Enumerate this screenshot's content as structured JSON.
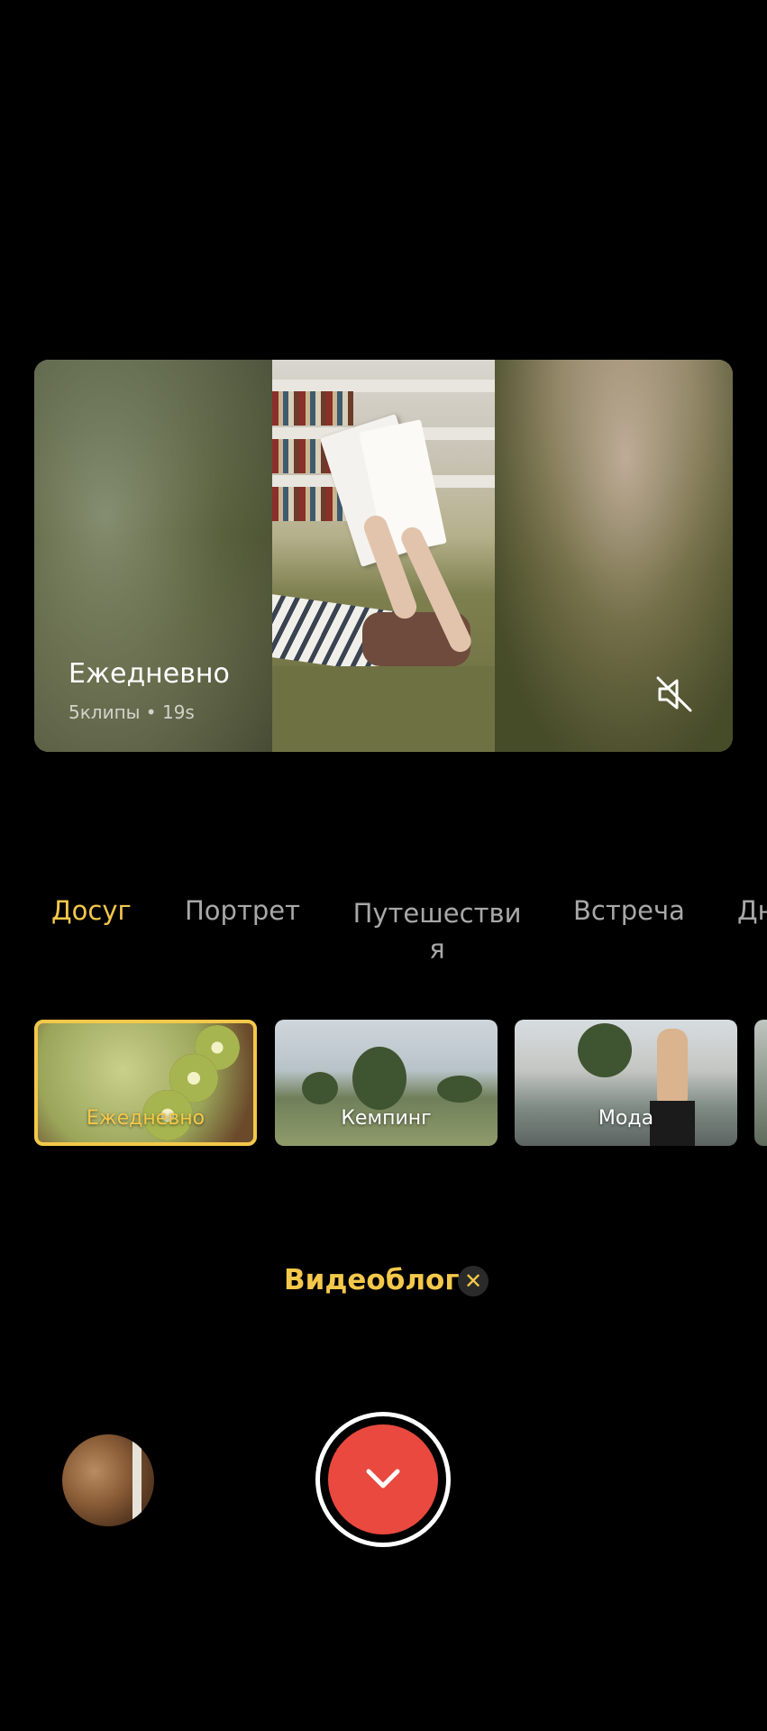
{
  "preview": {
    "title": "Ежедневно",
    "subtitle": "5клипы • 19s",
    "mute_icon": "speaker-muted-icon"
  },
  "categories": {
    "items": [
      "Досуг",
      "Портрет",
      "Путешестви",
      "я",
      "Встреча",
      "Дн"
    ],
    "active": "Досуг"
  },
  "templates": [
    {
      "label": "Ежедневно",
      "selected": true
    },
    {
      "label": "Кемпинг",
      "selected": false
    },
    {
      "label": "Мода",
      "selected": false
    }
  ],
  "mode": {
    "label": "Видеоблог",
    "close_icon": "close-icon",
    "close_glyph": "✕"
  },
  "controls": {
    "gallery": "gallery-thumbnail",
    "shutter_icon": "chevron-down-icon"
  },
  "colors": {
    "accent": "#f4c84a",
    "shutter": "#e9493e",
    "inactive_text": "#a8a8a8"
  }
}
